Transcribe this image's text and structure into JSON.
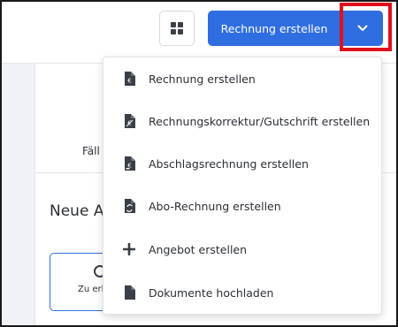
{
  "toolbar": {
    "primary_label": "Rechnung erstellen",
    "grid_icon": "apps-grid-icon",
    "dropdown_icon": "chevron-down-icon",
    "accent_color": "#2f6ee0",
    "highlight_color": "#e0101a"
  },
  "background": {
    "partial_tab_text": "Fäll",
    "partial_heading": "Neue A",
    "partial_upload_text": "Zu erl"
  },
  "menu": {
    "items": [
      {
        "label": "Rechnung erstellen",
        "icon": "invoice-document-icon"
      },
      {
        "label": "Rechnungskorrektur/Gutschrift erstellen",
        "icon": "correction-document-icon"
      },
      {
        "label": "Abschlagsrechnung erstellen",
        "icon": "partial-invoice-document-icon"
      },
      {
        "label": "Abo-Rechnung erstellen",
        "icon": "recurring-invoice-icon"
      },
      {
        "label": "Angebot erstellen",
        "icon": "plus-icon"
      },
      {
        "label": "Dokumente hochladen",
        "icon": "document-icon"
      }
    ]
  }
}
